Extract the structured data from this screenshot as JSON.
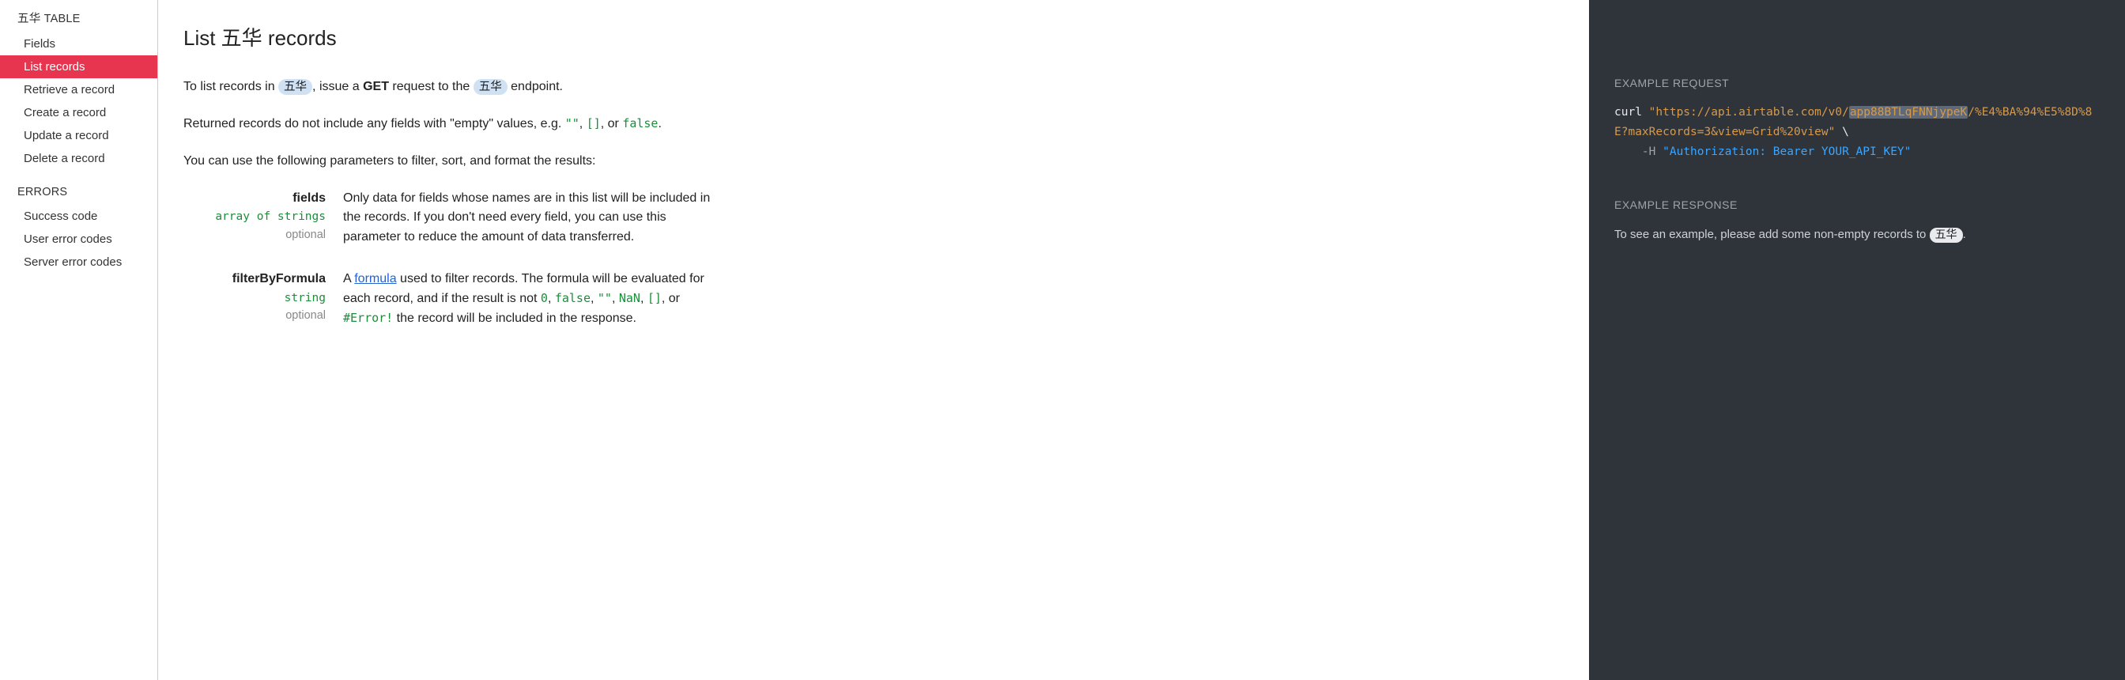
{
  "sidebar": {
    "table_section_label": "五华 TABLE",
    "table_items": [
      {
        "label": "Fields",
        "active": false
      },
      {
        "label": "List records",
        "active": true
      },
      {
        "label": "Retrieve a record",
        "active": false
      },
      {
        "label": "Create a record",
        "active": false
      },
      {
        "label": "Update a record",
        "active": false
      },
      {
        "label": "Delete a record",
        "active": false
      }
    ],
    "errors_section_label": "ERRORS",
    "errors_items": [
      {
        "label": "Success code"
      },
      {
        "label": "User error codes"
      },
      {
        "label": "Server error codes"
      }
    ]
  },
  "main": {
    "title": "List 五华 records",
    "intro_pre": "To list records in ",
    "intro_badge1": "五华",
    "intro_mid1": ", issue a ",
    "intro_get": "GET",
    "intro_mid2": " request to the ",
    "intro_badge2": "五华",
    "intro_post": " endpoint.",
    "empty_pre": "Returned records do not include any fields with \"empty\" values, e.g. ",
    "empty_c1": "\"\"",
    "empty_c2": "[]",
    "empty_or": ", or ",
    "empty_c3": "false",
    "empty_period": ".",
    "filter_intro": "You can use the following parameters to filter, sort, and format the results:",
    "params": {
      "fields": {
        "name": "fields",
        "type": "array of strings",
        "optional": "optional",
        "desc": "Only data for fields whose names are in this list will be included in the records. If you don't need every field, you can use this parameter to reduce the amount of data transferred."
      },
      "filterByFormula": {
        "name": "filterByFormula",
        "type": "string",
        "optional": "optional",
        "desc_pre": "A ",
        "desc_link": "formula",
        "desc_mid": " used to filter records. The formula will be evaluated for each record, and if the result is not ",
        "c0": "0",
        "c_false": "false",
        "c_empty": "\"\"",
        "c_nan": "NaN",
        "c_arr": "[]",
        "c_or": ", or ",
        "c_err": "#Error!",
        "desc_post": " the record will be included in the response."
      }
    }
  },
  "right": {
    "req_label": "EXAMPLE REQUEST",
    "curl": {
      "cmd": "curl ",
      "q": "\"",
      "url_pre": "https://api.airtable.com/v0/",
      "app_id": "app88BTLqFNNjypeK",
      "url_post": "/%E4%BA%94%E5%8D%8E?maxRecords=3&view=Grid%20view",
      "bslash": " \\",
      "indent": "    ",
      "flag": "-H ",
      "hdr": "\"Authorization: Bearer YOUR_API_KEY\""
    },
    "resp_label": "EXAMPLE RESPONSE",
    "resp_note_pre": "To see an example, please add some non-empty records to ",
    "resp_note_badge": "五华",
    "resp_note_post": "."
  }
}
